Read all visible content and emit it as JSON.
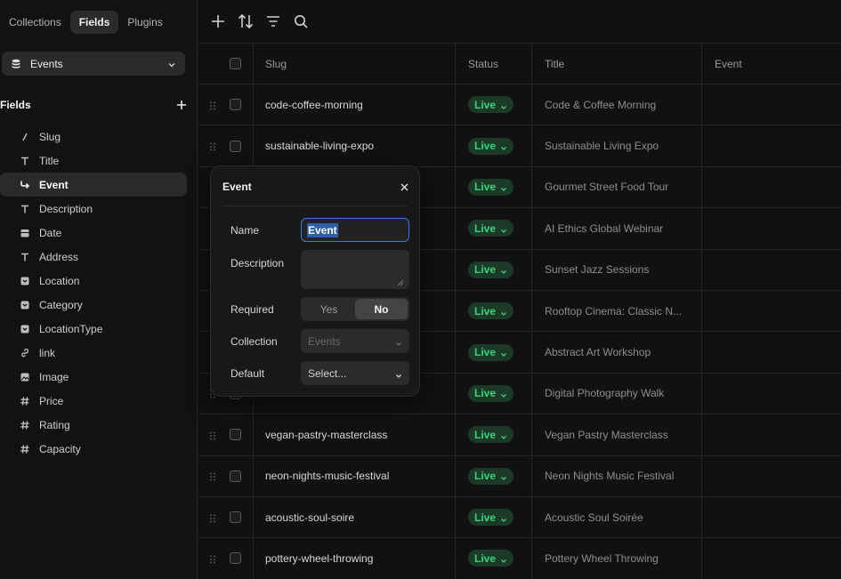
{
  "sidebar": {
    "tabs": [
      {
        "label": "Collections",
        "active": false
      },
      {
        "label": "Fields",
        "active": true
      },
      {
        "label": "Plugins",
        "active": false
      }
    ],
    "collection_select": {
      "value": "Events",
      "icon": "database-icon"
    },
    "fields_heading": "Fields",
    "fields": [
      {
        "label": "Slug",
        "icon": "slash-icon"
      },
      {
        "label": "Title",
        "icon": "text-icon"
      },
      {
        "label": "Event",
        "icon": "reference-arrow-icon",
        "active": true
      },
      {
        "label": "Description",
        "icon": "text-icon"
      },
      {
        "label": "Date",
        "icon": "calendar-icon"
      },
      {
        "label": "Address",
        "icon": "text-icon"
      },
      {
        "label": "Location",
        "icon": "option-icon"
      },
      {
        "label": "Category",
        "icon": "option-icon"
      },
      {
        "label": "LocationType",
        "icon": "option-icon"
      },
      {
        "label": "link",
        "icon": "link-icon"
      },
      {
        "label": "Image",
        "icon": "image-icon"
      },
      {
        "label": "Price",
        "icon": "number-icon"
      },
      {
        "label": "Rating",
        "icon": "number-icon"
      },
      {
        "label": "Capacity",
        "icon": "number-icon"
      }
    ]
  },
  "toolbar": {
    "icons": [
      "add-icon",
      "sort-icon",
      "filter-icon",
      "search-icon"
    ]
  },
  "table": {
    "headers": {
      "slug": "Slug",
      "status": "Status",
      "title": "Title",
      "event": "Event"
    },
    "rows": [
      {
        "slug": "code-coffee-morning",
        "status": "Live",
        "title": "Code & Coffee Morning",
        "event": ""
      },
      {
        "slug": "sustainable-living-expo",
        "status": "Live",
        "title": "Sustainable Living Expo",
        "event": ""
      },
      {
        "slug": "",
        "status": "Live",
        "title": "Gourmet Street Food Tour",
        "event": ""
      },
      {
        "slug": "",
        "status": "Live",
        "title": "AI Ethics Global Webinar",
        "event": ""
      },
      {
        "slug": "",
        "status": "Live",
        "title": "Sunset Jazz Sessions",
        "event": ""
      },
      {
        "slug": "",
        "status": "Live",
        "title": "Rooftop Cinema: Classic N...",
        "event": ""
      },
      {
        "slug": "",
        "status": "Live",
        "title": "Abstract Art Workshop",
        "event": ""
      },
      {
        "slug": "",
        "status": "Live",
        "title": "Digital Photography Walk",
        "event": ""
      },
      {
        "slug": "vegan-pastry-masterclass",
        "status": "Live",
        "title": "Vegan Pastry Masterclass",
        "event": ""
      },
      {
        "slug": "neon-nights-music-festival",
        "status": "Live",
        "title": "Neon Nights Music Festival",
        "event": ""
      },
      {
        "slug": "acoustic-soul-soire",
        "status": "Live",
        "title": "Acoustic Soul Soirée",
        "event": ""
      },
      {
        "slug": "pottery-wheel-throwing",
        "status": "Live",
        "title": "Pottery Wheel Throwing",
        "event": ""
      }
    ]
  },
  "popover": {
    "title": "Event",
    "name_label": "Name",
    "name_value": "Event",
    "description_label": "Description",
    "description_value": "",
    "required_label": "Required",
    "required_options": [
      "Yes",
      "No"
    ],
    "required_selected": "No",
    "collection_label": "Collection",
    "collection_value": "Events",
    "default_label": "Default",
    "default_value": "Select..."
  },
  "colors": {
    "background": "#111111",
    "live_text": "#34d67b",
    "live_bg": "#1d3a29",
    "focus_border": "#3a7bd5"
  }
}
